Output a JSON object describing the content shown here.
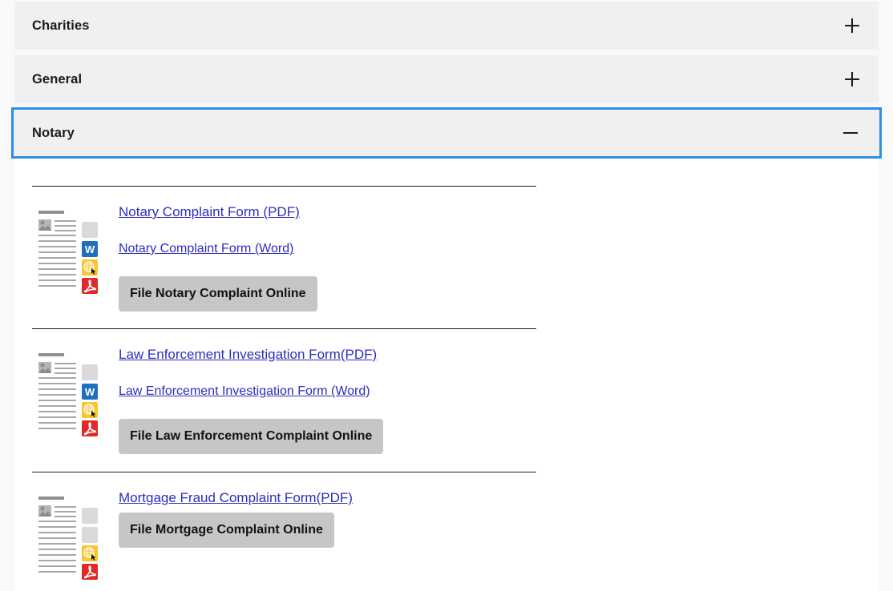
{
  "accordion": {
    "sections": [
      {
        "title": "Charities",
        "toggle_icon": "plus-icon",
        "expanded": false
      },
      {
        "title": "General",
        "toggle_icon": "plus-icon",
        "expanded": false
      },
      {
        "title": "Notary",
        "toggle_icon": "minus-icon",
        "expanded": true
      }
    ]
  },
  "notary": {
    "items": [
      {
        "thumbnail_icon": "document-thumbnail-icon",
        "badges": [
          "blank",
          "word",
          "web",
          "pdf"
        ],
        "links": [
          {
            "label": "Notary Complaint Form (PDF)",
            "type": "pdf"
          },
          {
            "label": "Notary Complaint Form (Word)",
            "type": "word"
          }
        ],
        "button": "File Notary Complaint Online"
      },
      {
        "thumbnail_icon": "document-thumbnail-icon",
        "badges": [
          "blank",
          "word",
          "web",
          "pdf"
        ],
        "links": [
          {
            "label": "Law Enforcement Investigation Form(PDF)",
            "type": "pdf"
          },
          {
            "label": "Law Enforcement Investigation Form (Word)",
            "type": "word"
          }
        ],
        "button": "File Law Enforcement Complaint Online"
      },
      {
        "thumbnail_icon": "document-thumbnail-icon",
        "badges": [
          "blank",
          "blank",
          "web",
          "pdf"
        ],
        "links": [
          {
            "label": "Mortgage Fraud Complaint Form(PDF)",
            "type": "pdf"
          }
        ],
        "button": "File Mortgage Complaint Online"
      }
    ]
  },
  "colors": {
    "focus_border": "#2e8ee6",
    "header_bg": "#f0f0f0",
    "link": "#2d2dbd",
    "button_bg": "#c6c6c6",
    "word_badge": "#1f6fc1",
    "web_badge": "#f7c631",
    "pdf_badge": "#e02a2a"
  }
}
